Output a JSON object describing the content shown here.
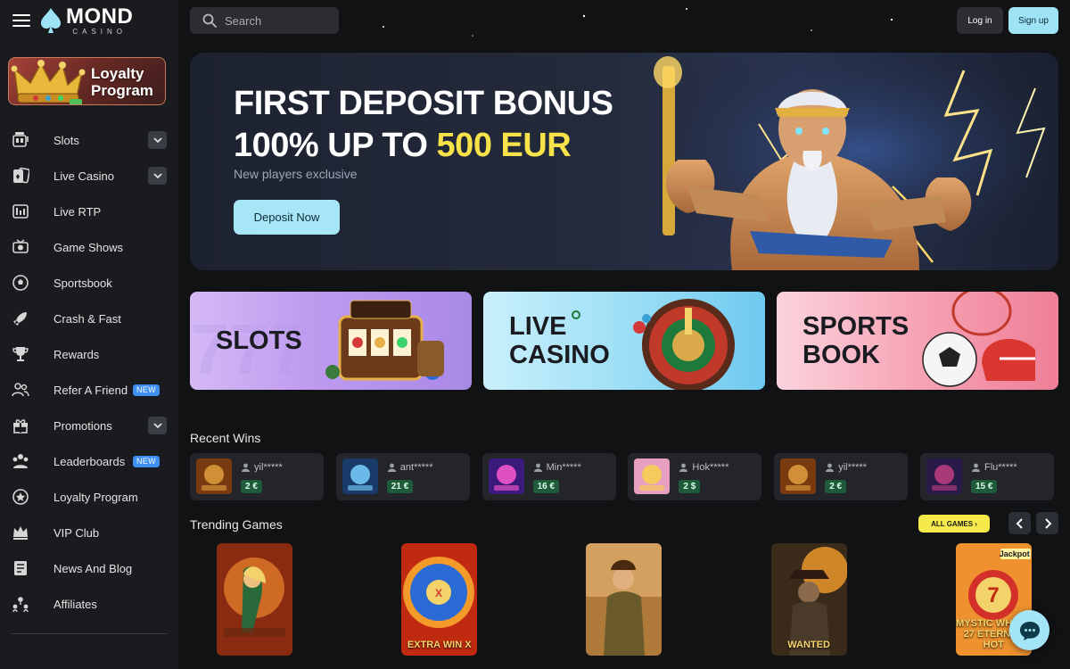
{
  "brand": {
    "name": "MOND",
    "sub": "CASINO"
  },
  "sidebar": {
    "loyalty_card": {
      "line1": "Loyalty",
      "line2": "Program"
    },
    "items": [
      {
        "label": "Slots",
        "icon": "slot-machine-icon",
        "has_chevron": true
      },
      {
        "label": "Live Casino",
        "icon": "cards-icon",
        "has_chevron": true
      },
      {
        "label": "Live RTP",
        "icon": "rtp-icon"
      },
      {
        "label": "Game Shows",
        "icon": "game-show-icon"
      },
      {
        "label": "Sportsbook",
        "icon": "soccer-ball-icon"
      },
      {
        "label": "Crash & Fast",
        "icon": "rocket-icon"
      },
      {
        "label": "Rewards",
        "icon": "trophy-icon"
      },
      {
        "label": "Refer A Friend",
        "icon": "users-icon",
        "badge": "NEW"
      },
      {
        "label": "Promotions",
        "icon": "gift-icon",
        "has_chevron": true
      },
      {
        "label": "Leaderboards",
        "icon": "leaderboard-icon",
        "badge": "NEW"
      },
      {
        "label": "Loyalty Program",
        "icon": "loyalty-icon"
      },
      {
        "label": "VIP Club",
        "icon": "crown-icon"
      },
      {
        "label": "News And Blog",
        "icon": "news-icon"
      },
      {
        "label": "Affiliates",
        "icon": "affiliates-icon"
      }
    ]
  },
  "header": {
    "search_placeholder": "Search",
    "login_label": "Log in",
    "signup_label": "Sign up"
  },
  "hero": {
    "line1": "FIRST DEPOSIT BONUS",
    "line2_prefix": "100% UP TO ",
    "line2_highlight": "500 EUR",
    "subtitle": "New players exclusive",
    "cta": "Deposit Now"
  },
  "categories": [
    {
      "line1": "SLOTS",
      "line2": ""
    },
    {
      "line1": "LIVE",
      "line2": "CASINO"
    },
    {
      "line1": "SPORTS",
      "line2": "BOOK"
    }
  ],
  "recent_wins": {
    "title": "Recent Wins",
    "items": [
      {
        "user": "yil*****",
        "amount": "2 €"
      },
      {
        "user": "ant*****",
        "amount": "21 €"
      },
      {
        "user": "Min*****",
        "amount": "16 €"
      },
      {
        "user": "Hok*****",
        "amount": "2 $"
      },
      {
        "user": "yil*****",
        "amount": "2 €"
      },
      {
        "user": "Flu*****",
        "amount": "15 €"
      }
    ]
  },
  "trending": {
    "title": "Trending Games",
    "all_games": "ALL GAMES",
    "games": [
      {
        "name": ""
      },
      {
        "name": "EXTRA WIN X"
      },
      {
        "name": ""
      },
      {
        "name": "WANTED"
      },
      {
        "name": "MYSTIC WHEEL 27 ETERNAL HOT",
        "badge": "Jackpot"
      }
    ]
  },
  "colors": {
    "accent_cyan": "#a7e6f7",
    "highlight_yellow": "#f8e24a",
    "badge_blue": "#3d8ff0",
    "win_green": "#1f5a3a"
  }
}
